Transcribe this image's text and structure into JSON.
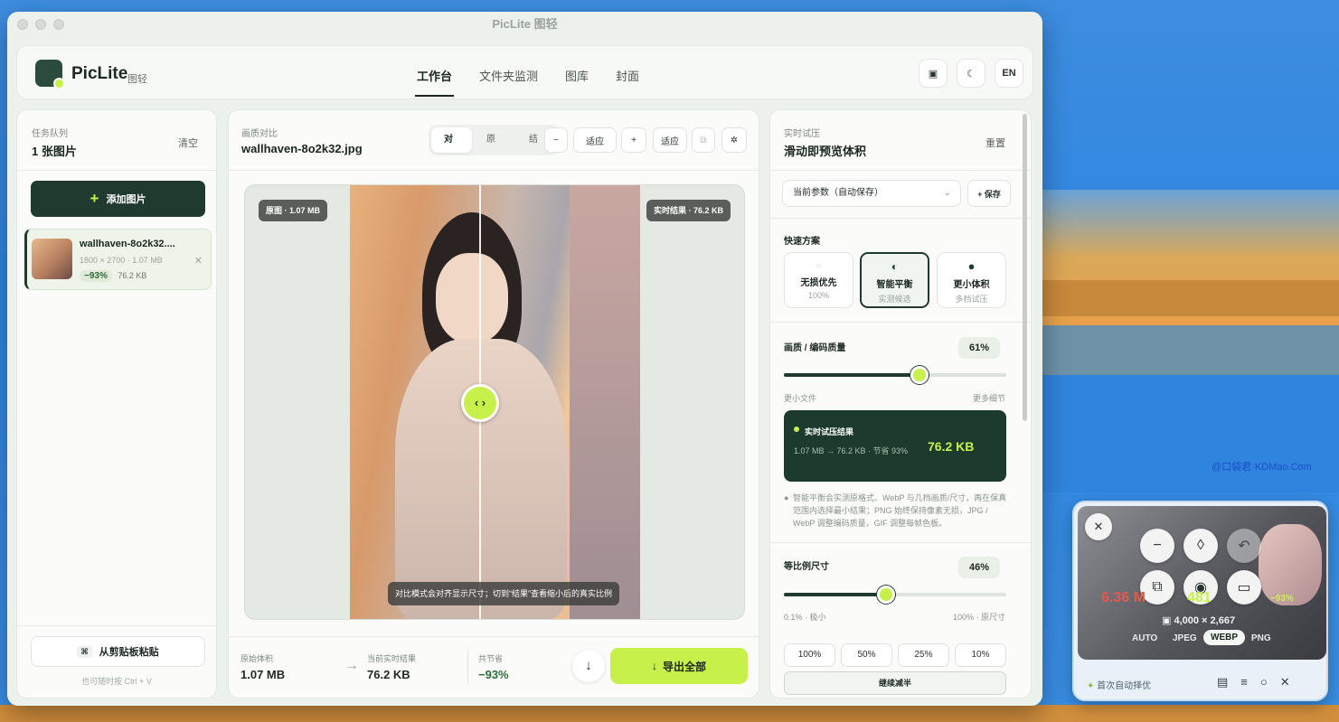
{
  "window": {
    "title": "PicLite 图轻"
  },
  "brand": {
    "name": "PicLite",
    "sub": "图轻"
  },
  "nav": {
    "tabs": [
      "工作台",
      "文件夹监测",
      "图库",
      "封面"
    ],
    "active_index": 0
  },
  "toolbar": {
    "layout_icon": "▣",
    "theme_icon": "☾",
    "lang": "EN"
  },
  "queue": {
    "caption": "任务队列",
    "title": "1 张图片",
    "clear": "清空",
    "add_button": "添加图片",
    "items": [
      {
        "name": "wallhaven-8o2k32....",
        "meta": "1800 × 2700 · 1.07 MB",
        "ratio": "−93%",
        "size": "76.2 KB"
      }
    ],
    "paste_button": "从剪贴板粘贴",
    "paste_key": "⌘",
    "paste_hint": "也可随时按 Ctrl + V"
  },
  "compare": {
    "caption": "画质对比",
    "filename": "wallhaven-8o2k32.jpg",
    "modes": [
      "对比",
      "原图",
      "结果"
    ],
    "active_mode": 0,
    "zoom_out": "−",
    "fit": "适应",
    "zoom_in": "+",
    "fit2": "适应",
    "tag_left": "原图 · 1.07 MB",
    "tag_right": "实时结果 · 76.2 KB",
    "hint": "对比模式会对齐显示尺寸；切到“结果”查看缩小后的真实比例",
    "handle": "‹ ›"
  },
  "footer": {
    "orig_label": "原始体积",
    "orig_value": "1.07 MB",
    "cur_label": "当前实时结果",
    "cur_value": "76.2 KB",
    "save_label": "共节省",
    "save_value": "−93%",
    "download_icon": "↓",
    "export_button": "导出全部"
  },
  "trial": {
    "caption": "实时试压",
    "title": "滑动即预览体积",
    "reset": "重置",
    "preset_select": "当前参数（自动保存）",
    "save_preset": "+ 保存",
    "quick_title": "快速方案",
    "presets": [
      {
        "title": "无损优先",
        "sub": "100%",
        "icon": "○"
      },
      {
        "title": "智能平衡",
        "sub": "实测候选",
        "icon": "◐"
      },
      {
        "title": "更小体积",
        "sub": "多档试压",
        "icon": "●"
      }
    ],
    "active_preset": 1,
    "quality_label": "画质 / 编码质量",
    "quality_value": "61%",
    "quality_level": 0.61,
    "quality_min": "更小文件",
    "quality_max": "更多细节",
    "result_title": "实时试压结果",
    "result_detail": "1.07 MB → 76.2 KB · 节省 93%",
    "result_size": "76.2 KB",
    "note": "智能平衡会实测原格式、WebP 与几档画质/尺寸，再在保真范围内选择最小结果；PNG 始终保持像素无损，JPG / WebP 调整编码质量，GIF 调整每帧色板。",
    "scale_label": "等比例尺寸",
    "scale_value": "46%",
    "scale_level": 0.46,
    "scale_min": "0.1% · 极小",
    "scale_max": "100% · 原尺寸",
    "scale_buttons": [
      "100%",
      "50%",
      "25%",
      "10%"
    ],
    "continue_button": "继续减半"
  },
  "floating": {
    "big_left": "6.36 M",
    "arrow": "→",
    "big_right": "481",
    "ratio": "−93%",
    "dims": "4,000 × 2,667",
    "formats": [
      "AUTO",
      "JPEG",
      "WEBP",
      "PNG"
    ],
    "active_format": 2,
    "bottom_label": "首次自动择优",
    "close_icon": "✕",
    "minus": "−",
    "drop": "◊",
    "undo": "↶",
    "copy": "⧉",
    "eye": "◉",
    "folder": "▭"
  },
  "watermark": "@口袋君·KDMao.Com",
  "colors": {
    "accent": "#c7f04a",
    "dark": "#203a2f",
    "page": "#edf1ec"
  }
}
